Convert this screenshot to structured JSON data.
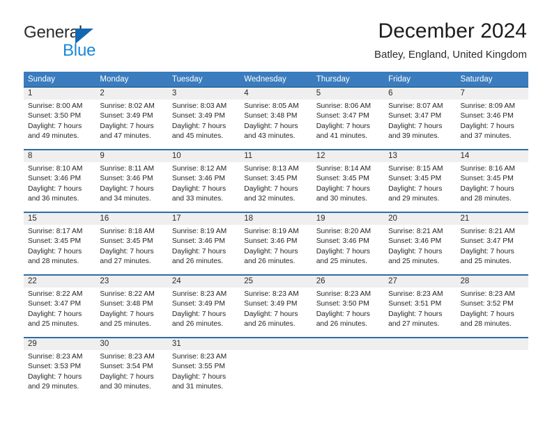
{
  "logo": {
    "word_top": "General",
    "word_bottom": "Blue",
    "triangle": "triangle-icon",
    "color_dark": "#2b2b2b",
    "color_blue": "#1a87d8"
  },
  "header": {
    "title": "December 2024",
    "subtitle": "Batley, England, United Kingdom"
  },
  "theme": {
    "header_row_bg": "#3a7cbe",
    "cell_divider": "#2e6da4",
    "daynum_bg": "#efefef"
  },
  "weekday_headers": [
    "Sunday",
    "Monday",
    "Tuesday",
    "Wednesday",
    "Thursday",
    "Friday",
    "Saturday"
  ],
  "labels": {
    "sunrise": "Sunrise:",
    "sunset": "Sunset:",
    "daylight": "Daylight:"
  },
  "weeks": [
    [
      {
        "day": "1",
        "sunrise": "Sunrise: 8:00 AM",
        "sunset": "Sunset: 3:50 PM",
        "daylight_1": "Daylight: 7 hours",
        "daylight_2": "and 49 minutes."
      },
      {
        "day": "2",
        "sunrise": "Sunrise: 8:02 AM",
        "sunset": "Sunset: 3:49 PM",
        "daylight_1": "Daylight: 7 hours",
        "daylight_2": "and 47 minutes."
      },
      {
        "day": "3",
        "sunrise": "Sunrise: 8:03 AM",
        "sunset": "Sunset: 3:49 PM",
        "daylight_1": "Daylight: 7 hours",
        "daylight_2": "and 45 minutes."
      },
      {
        "day": "4",
        "sunrise": "Sunrise: 8:05 AM",
        "sunset": "Sunset: 3:48 PM",
        "daylight_1": "Daylight: 7 hours",
        "daylight_2": "and 43 minutes."
      },
      {
        "day": "5",
        "sunrise": "Sunrise: 8:06 AM",
        "sunset": "Sunset: 3:47 PM",
        "daylight_1": "Daylight: 7 hours",
        "daylight_2": "and 41 minutes."
      },
      {
        "day": "6",
        "sunrise": "Sunrise: 8:07 AM",
        "sunset": "Sunset: 3:47 PM",
        "daylight_1": "Daylight: 7 hours",
        "daylight_2": "and 39 minutes."
      },
      {
        "day": "7",
        "sunrise": "Sunrise: 8:09 AM",
        "sunset": "Sunset: 3:46 PM",
        "daylight_1": "Daylight: 7 hours",
        "daylight_2": "and 37 minutes."
      }
    ],
    [
      {
        "day": "8",
        "sunrise": "Sunrise: 8:10 AM",
        "sunset": "Sunset: 3:46 PM",
        "daylight_1": "Daylight: 7 hours",
        "daylight_2": "and 36 minutes."
      },
      {
        "day": "9",
        "sunrise": "Sunrise: 8:11 AM",
        "sunset": "Sunset: 3:46 PM",
        "daylight_1": "Daylight: 7 hours",
        "daylight_2": "and 34 minutes."
      },
      {
        "day": "10",
        "sunrise": "Sunrise: 8:12 AM",
        "sunset": "Sunset: 3:46 PM",
        "daylight_1": "Daylight: 7 hours",
        "daylight_2": "and 33 minutes."
      },
      {
        "day": "11",
        "sunrise": "Sunrise: 8:13 AM",
        "sunset": "Sunset: 3:45 PM",
        "daylight_1": "Daylight: 7 hours",
        "daylight_2": "and 32 minutes."
      },
      {
        "day": "12",
        "sunrise": "Sunrise: 8:14 AM",
        "sunset": "Sunset: 3:45 PM",
        "daylight_1": "Daylight: 7 hours",
        "daylight_2": "and 30 minutes."
      },
      {
        "day": "13",
        "sunrise": "Sunrise: 8:15 AM",
        "sunset": "Sunset: 3:45 PM",
        "daylight_1": "Daylight: 7 hours",
        "daylight_2": "and 29 minutes."
      },
      {
        "day": "14",
        "sunrise": "Sunrise: 8:16 AM",
        "sunset": "Sunset: 3:45 PM",
        "daylight_1": "Daylight: 7 hours",
        "daylight_2": "and 28 minutes."
      }
    ],
    [
      {
        "day": "15",
        "sunrise": "Sunrise: 8:17 AM",
        "sunset": "Sunset: 3:45 PM",
        "daylight_1": "Daylight: 7 hours",
        "daylight_2": "and 28 minutes."
      },
      {
        "day": "16",
        "sunrise": "Sunrise: 8:18 AM",
        "sunset": "Sunset: 3:45 PM",
        "daylight_1": "Daylight: 7 hours",
        "daylight_2": "and 27 minutes."
      },
      {
        "day": "17",
        "sunrise": "Sunrise: 8:19 AM",
        "sunset": "Sunset: 3:46 PM",
        "daylight_1": "Daylight: 7 hours",
        "daylight_2": "and 26 minutes."
      },
      {
        "day": "18",
        "sunrise": "Sunrise: 8:19 AM",
        "sunset": "Sunset: 3:46 PM",
        "daylight_1": "Daylight: 7 hours",
        "daylight_2": "and 26 minutes."
      },
      {
        "day": "19",
        "sunrise": "Sunrise: 8:20 AM",
        "sunset": "Sunset: 3:46 PM",
        "daylight_1": "Daylight: 7 hours",
        "daylight_2": "and 25 minutes."
      },
      {
        "day": "20",
        "sunrise": "Sunrise: 8:21 AM",
        "sunset": "Sunset: 3:46 PM",
        "daylight_1": "Daylight: 7 hours",
        "daylight_2": "and 25 minutes."
      },
      {
        "day": "21",
        "sunrise": "Sunrise: 8:21 AM",
        "sunset": "Sunset: 3:47 PM",
        "daylight_1": "Daylight: 7 hours",
        "daylight_2": "and 25 minutes."
      }
    ],
    [
      {
        "day": "22",
        "sunrise": "Sunrise: 8:22 AM",
        "sunset": "Sunset: 3:47 PM",
        "daylight_1": "Daylight: 7 hours",
        "daylight_2": "and 25 minutes."
      },
      {
        "day": "23",
        "sunrise": "Sunrise: 8:22 AM",
        "sunset": "Sunset: 3:48 PM",
        "daylight_1": "Daylight: 7 hours",
        "daylight_2": "and 25 minutes."
      },
      {
        "day": "24",
        "sunrise": "Sunrise: 8:23 AM",
        "sunset": "Sunset: 3:49 PM",
        "daylight_1": "Daylight: 7 hours",
        "daylight_2": "and 26 minutes."
      },
      {
        "day": "25",
        "sunrise": "Sunrise: 8:23 AM",
        "sunset": "Sunset: 3:49 PM",
        "daylight_1": "Daylight: 7 hours",
        "daylight_2": "and 26 minutes."
      },
      {
        "day": "26",
        "sunrise": "Sunrise: 8:23 AM",
        "sunset": "Sunset: 3:50 PM",
        "daylight_1": "Daylight: 7 hours",
        "daylight_2": "and 26 minutes."
      },
      {
        "day": "27",
        "sunrise": "Sunrise: 8:23 AM",
        "sunset": "Sunset: 3:51 PM",
        "daylight_1": "Daylight: 7 hours",
        "daylight_2": "and 27 minutes."
      },
      {
        "day": "28",
        "sunrise": "Sunrise: 8:23 AM",
        "sunset": "Sunset: 3:52 PM",
        "daylight_1": "Daylight: 7 hours",
        "daylight_2": "and 28 minutes."
      }
    ],
    [
      {
        "day": "29",
        "sunrise": "Sunrise: 8:23 AM",
        "sunset": "Sunset: 3:53 PM",
        "daylight_1": "Daylight: 7 hours",
        "daylight_2": "and 29 minutes."
      },
      {
        "day": "30",
        "sunrise": "Sunrise: 8:23 AM",
        "sunset": "Sunset: 3:54 PM",
        "daylight_1": "Daylight: 7 hours",
        "daylight_2": "and 30 minutes."
      },
      {
        "day": "31",
        "sunrise": "Sunrise: 8:23 AM",
        "sunset": "Sunset: 3:55 PM",
        "daylight_1": "Daylight: 7 hours",
        "daylight_2": "and 31 minutes."
      },
      {
        "day": "",
        "sunrise": "",
        "sunset": "",
        "daylight_1": "",
        "daylight_2": ""
      },
      {
        "day": "",
        "sunrise": "",
        "sunset": "",
        "daylight_1": "",
        "daylight_2": ""
      },
      {
        "day": "",
        "sunrise": "",
        "sunset": "",
        "daylight_1": "",
        "daylight_2": ""
      },
      {
        "day": "",
        "sunrise": "",
        "sunset": "",
        "daylight_1": "",
        "daylight_2": ""
      }
    ]
  ]
}
